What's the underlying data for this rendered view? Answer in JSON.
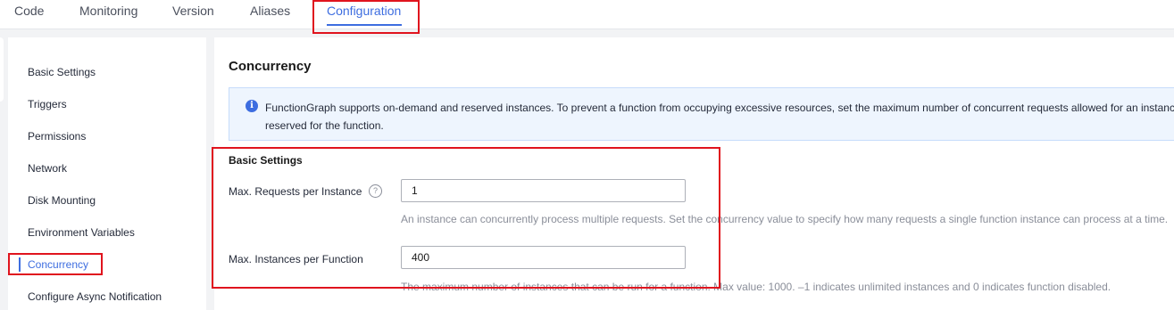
{
  "tabs": [
    {
      "label": "Code"
    },
    {
      "label": "Monitoring"
    },
    {
      "label": "Version"
    },
    {
      "label": "Aliases"
    },
    {
      "label": "Configuration",
      "active": true
    }
  ],
  "sidebar": {
    "items": [
      {
        "label": "Basic Settings"
      },
      {
        "label": "Triggers"
      },
      {
        "label": "Permissions"
      },
      {
        "label": "Network"
      },
      {
        "label": "Disk Mounting"
      },
      {
        "label": "Environment Variables"
      },
      {
        "label": "Concurrency",
        "active": true
      },
      {
        "label": "Configure Async Notification"
      }
    ]
  },
  "main": {
    "title": "Concurrency",
    "info_line1": "FunctionGraph supports on-demand and reserved instances. To prevent a function from occupying excessive resources, set the maximum number of concurrent requests allowed for an instance",
    "info_line2": "reserved for the function.",
    "basic_settings_title": "Basic Settings",
    "max_requests": {
      "label": "Max. Requests per Instance",
      "value": "1",
      "hint": "An instance can concurrently process multiple requests. Set the concurrency value to specify how many requests a single function instance can process at a time."
    },
    "max_instances": {
      "label": "Max. Instances per Function",
      "value": "400",
      "hint": "The maximum number of instances that can be run for a function. Max value: 1000. –1 indicates unlimited instances and 0 indicates function disabled."
    }
  },
  "colors": {
    "accent": "#3d6de0",
    "highlight": "#e0141e",
    "info_bg": "#eef5fe"
  },
  "icons": {
    "info": "info-icon",
    "help": "help-circle-icon"
  }
}
